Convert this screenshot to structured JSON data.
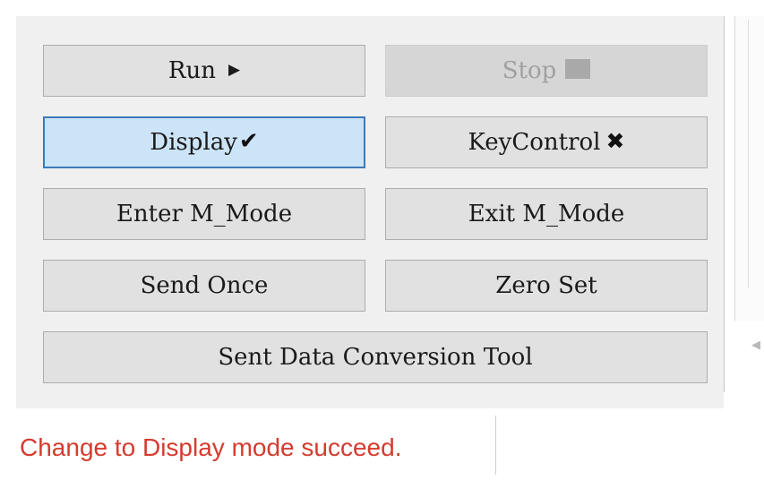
{
  "controls": {
    "run_label": "Run",
    "run_icon": "play-triangle",
    "stop_label": "Stop",
    "stop_icon": "stop-square",
    "display_label": "Display",
    "display_icon": "checkmark",
    "keycontrol_label": "KeyControl",
    "keycontrol_icon": "cross-mark",
    "enter_mmode_label": "Enter M_Mode",
    "exit_mmode_label": "Exit M_Mode",
    "send_once_label": "Send Once",
    "zero_set_label": "Zero Set",
    "conversion_tool_label": "Sent Data Conversion Tool"
  },
  "state": {
    "display_selected": true,
    "stop_enabled": false
  },
  "status": {
    "message": "Change to Display mode succeed.",
    "color": "#d43b2f"
  },
  "colors": {
    "panel_bg": "#f0f0f0",
    "button_bg": "#e1e1e1",
    "active_bg": "#cce4f7",
    "active_border": "#3d7ab8"
  }
}
